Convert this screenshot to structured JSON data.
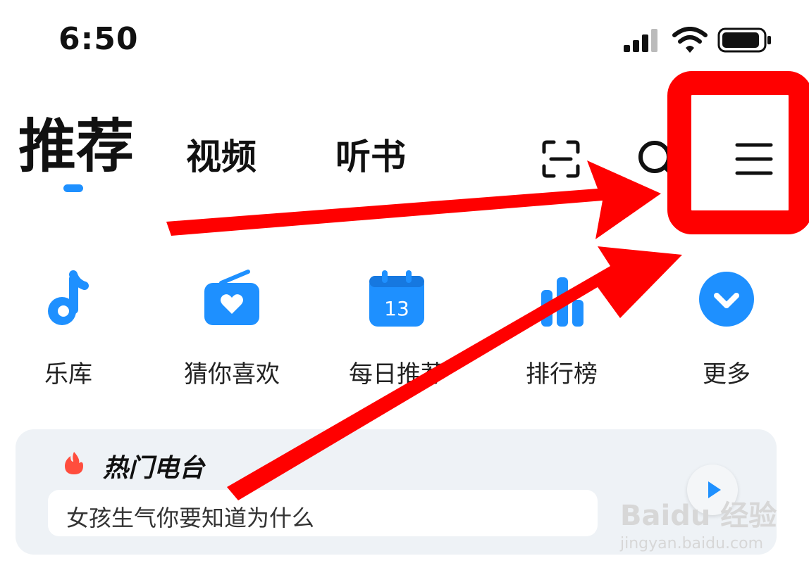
{
  "status_bar": {
    "time": "6:50"
  },
  "nav": {
    "tabs": [
      {
        "label": "推荐",
        "active": true
      },
      {
        "label": "视频",
        "active": false
      },
      {
        "label": "听书",
        "active": false
      }
    ],
    "icons": [
      "scan-icon",
      "search-icon",
      "menu-icon"
    ]
  },
  "quick_entries": [
    {
      "label": "乐库",
      "icon": "music-note-icon"
    },
    {
      "label": "猜你喜欢",
      "icon": "radio-heart-icon"
    },
    {
      "label": "每日推荐",
      "icon": "calendar-icon",
      "day": "13"
    },
    {
      "label": "排行榜",
      "icon": "bar-chart-icon"
    },
    {
      "label": "更多",
      "icon": "chevron-down-icon"
    }
  ],
  "hot_radio": {
    "title": "热门电台",
    "text": "女孩生气你要知道为什么",
    "icon": "fire-icon"
  },
  "watermark": {
    "brand": "Baidu 经验",
    "url": "jingyan.baidu.com"
  },
  "colors": {
    "accent": "#1e90ff",
    "annotation": "#ff0000",
    "card_bg": "#eef2f6",
    "fire": "#ff4d3d"
  }
}
